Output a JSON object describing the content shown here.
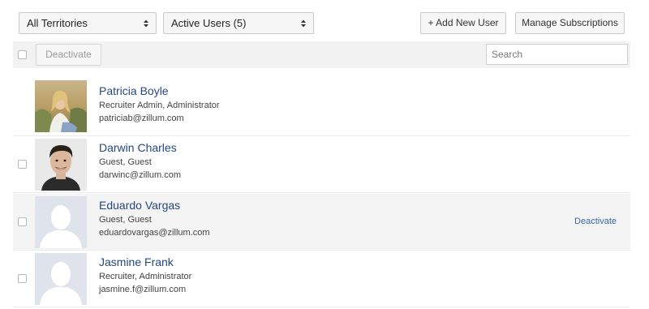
{
  "filters": {
    "territory": "All Territories",
    "users": "Active Users (5)"
  },
  "header_buttons": {
    "add_user": "+ Add New User",
    "manage_subscriptions": "Manage Subscriptions"
  },
  "toolbar": {
    "deactivate_label": "Deactivate",
    "search_placeholder": "Search"
  },
  "users": [
    {
      "name": "Patricia Boyle",
      "role": "Recruiter Admin, Administrator",
      "email": "patriciab@zillum.com",
      "avatar": "photo-avatar"
    },
    {
      "name": "Darwin Charles",
      "role": "Guest, Guest",
      "email": "darwinc@zillum.com",
      "avatar": "photo-avatar"
    },
    {
      "name": "Eduardo Vargas",
      "role": "Guest, Guest",
      "email": "eduardovargas@zillum.com",
      "avatar": "default-avatar",
      "row_action": "Deactivate"
    },
    {
      "name": "Jasmine Frank",
      "role": "Recruiter, Administrator",
      "email": "jasmine.f@zillum.com",
      "avatar": "default-avatar"
    }
  ],
  "colors": {
    "link": "#24487f",
    "action_link": "#3d68a8",
    "placeholder_avatar_bg": "#dfe3ec",
    "placeholder_avatar_fg": "#ffffff"
  }
}
